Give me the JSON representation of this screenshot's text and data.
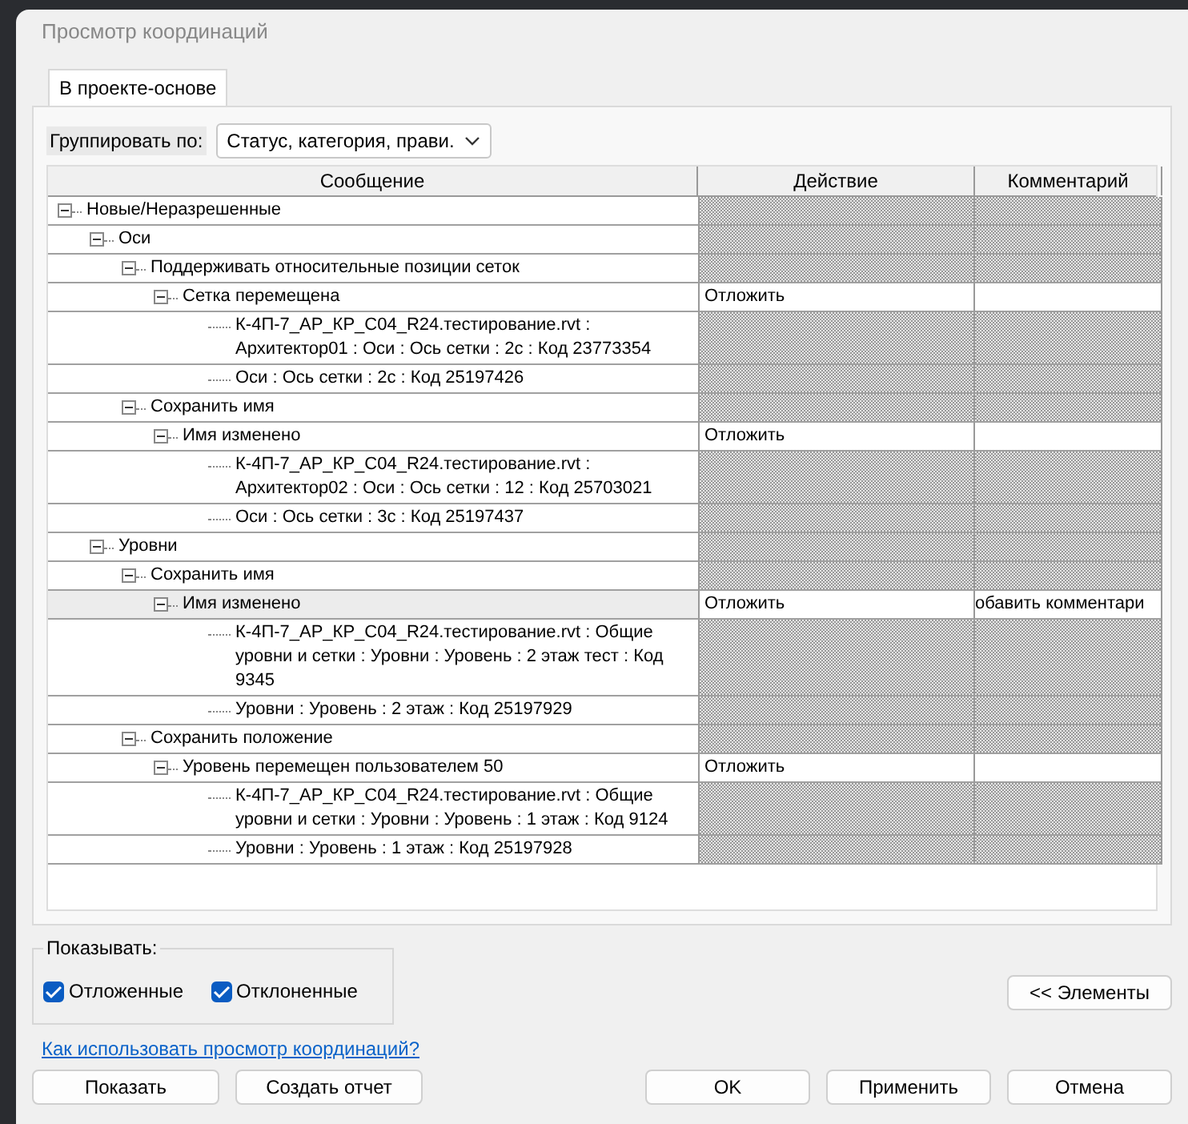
{
  "window": {
    "title": "Просмотр координаций"
  },
  "tabs": [
    {
      "label": "В проекте-основе",
      "selected": true
    }
  ],
  "group_by": {
    "label": "Группировать по:",
    "value": "Статус, категория, прави."
  },
  "table": {
    "columns": [
      "Сообщение",
      "Действие",
      "Комментарий"
    ],
    "rows": [
      {
        "label": "Новые/Неразрешенные",
        "expanded": true,
        "selected": false,
        "children": [
          {
            "label": "Оси",
            "expanded": true,
            "selected": false,
            "children": [
              {
                "label": "Поддерживать относительные позиции сеток",
                "expanded": true,
                "selected": false,
                "children": [
                  {
                    "label": "Сетка перемещена",
                    "expanded": true,
                    "selected": false,
                    "action": "Отложить",
                    "children": [
                      {
                        "label": "К-4П-7_АР_КР_С04_R24.тестирование.rvt : Архитектор01 : Оси : Ось сетки : 2с : Код 23773354",
                        "selected": false
                      },
                      {
                        "label": "Оси : Ось сетки : 2с : Код 25197426",
                        "selected": false
                      }
                    ]
                  }
                ]
              },
              {
                "label": "Сохранить имя",
                "expanded": true,
                "selected": false,
                "children": [
                  {
                    "label": "Имя изменено",
                    "expanded": true,
                    "selected": false,
                    "action": "Отложить",
                    "children": [
                      {
                        "label": "К-4П-7_АР_КР_С04_R24.тестирование.rvt : Архитектор02 : Оси : Ось сетки : 12 : Код 25703021",
                        "selected": false
                      },
                      {
                        "label": "Оси : Ось сетки : 3с : Код 25197437",
                        "selected": false
                      }
                    ]
                  }
                ]
              }
            ]
          },
          {
            "label": "Уровни",
            "expanded": true,
            "selected": false,
            "children": [
              {
                "label": "Сохранить имя",
                "expanded": true,
                "selected": false,
                "children": [
                  {
                    "label": "Имя изменено",
                    "expanded": true,
                    "selected": true,
                    "action": "Отложить",
                    "comment": "обавить комментари",
                    "children": [
                      {
                        "label": "К-4П-7_АР_КР_С04_R24.тестирование.rvt : Общие уровни и сетки : Уровни : Уровень : 2 этаж тест : Код 9345",
                        "selected": false
                      },
                      {
                        "label": "Уровни : Уровень : 2 этаж : Код 25197929",
                        "selected": false
                      }
                    ]
                  }
                ]
              },
              {
                "label": "Сохранить положение",
                "expanded": true,
                "selected": false,
                "children": [
                  {
                    "label": "Уровень перемещен пользователем 50",
                    "expanded": true,
                    "selected": false,
                    "action": "Отложить",
                    "children": [
                      {
                        "label": "К-4П-7_АР_КР_С04_R24.тестирование.rvt : Общие уровни и сетки : Уровни : Уровень : 1 этаж : Код 9124",
                        "selected": false
                      },
                      {
                        "label": "Уровни : Уровень : 1 этаж : Код 25197928",
                        "selected": false
                      }
                    ]
                  }
                ]
              }
            ]
          }
        ]
      }
    ]
  },
  "show": {
    "label": "Показывать:",
    "options": [
      {
        "label": "Отложенные",
        "checked": true
      },
      {
        "label": "Отклоненные",
        "checked": true
      }
    ]
  },
  "elements_button": "<< Элементы",
  "help_link": "Как использовать просмотр координаций?",
  "buttons_left": [
    "Показать",
    "Создать отчет"
  ],
  "buttons_right": [
    "OK",
    "Применить",
    "Отмена"
  ]
}
